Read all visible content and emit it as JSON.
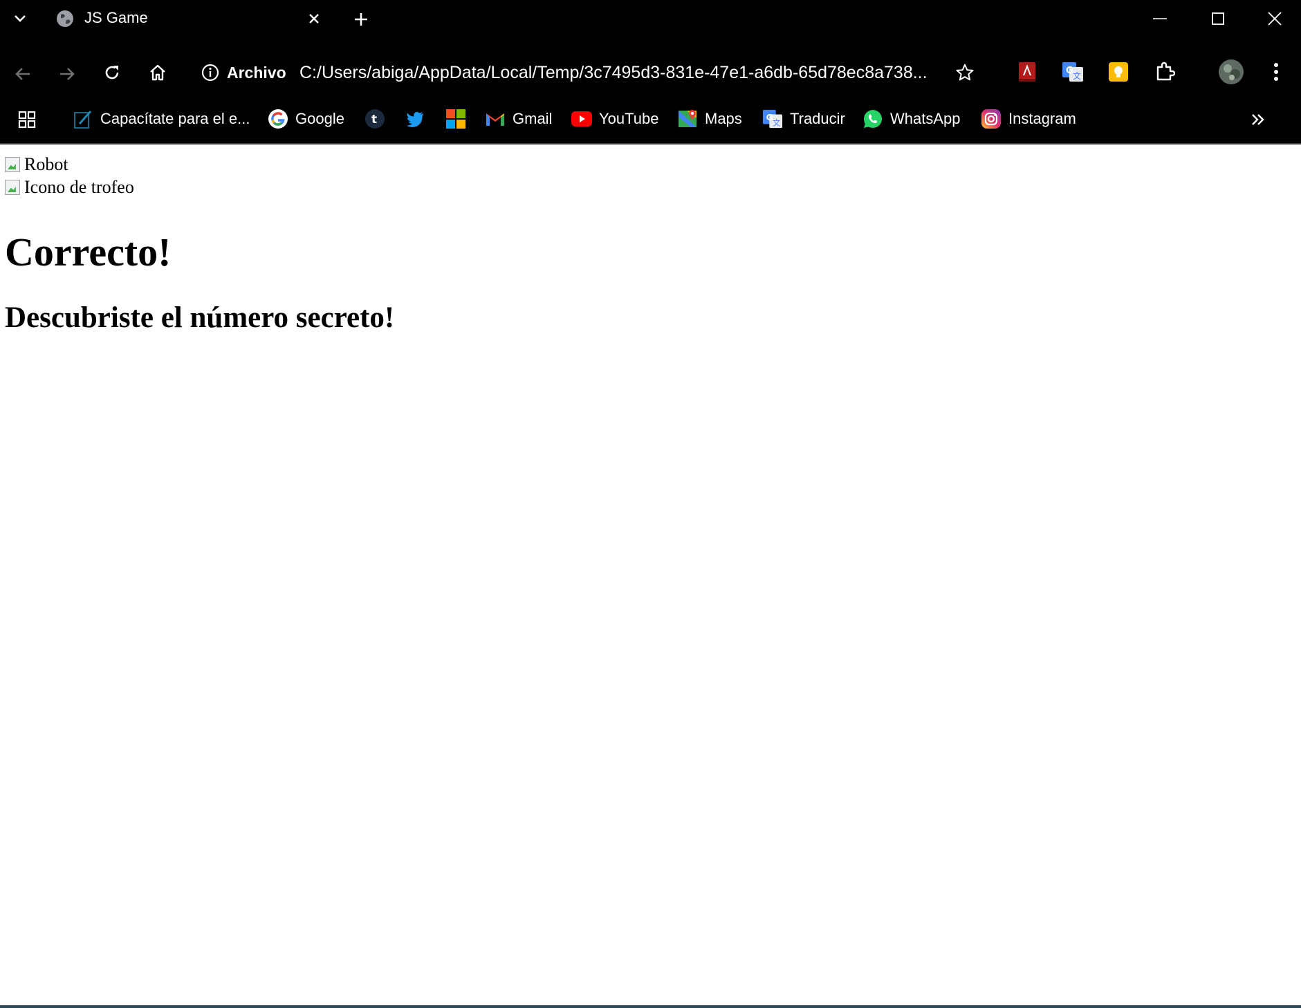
{
  "browser": {
    "tab": {
      "title": "JS Game"
    },
    "address": {
      "security_label": "Archivo",
      "url": "C:/Users/abiga/AppData/Local/Temp/3c7495d3-831e-47e1-a6db-65d78ec8a738..."
    },
    "bookmarks": [
      {
        "label": "Capacítate para el e...",
        "icon": "pen-icon"
      },
      {
        "label": "Google",
        "icon": "google-icon"
      },
      {
        "label": "",
        "icon": "tumblr-icon"
      },
      {
        "label": "",
        "icon": "twitter-icon"
      },
      {
        "label": "",
        "icon": "microsoft-icon"
      },
      {
        "label": "Gmail",
        "icon": "gmail-icon"
      },
      {
        "label": "YouTube",
        "icon": "youtube-icon"
      },
      {
        "label": "Maps",
        "icon": "maps-icon"
      },
      {
        "label": "Traducir",
        "icon": "translate-icon"
      },
      {
        "label": "WhatsApp",
        "icon": "whatsapp-icon"
      },
      {
        "label": "Instagram",
        "icon": "instagram-icon"
      }
    ],
    "colors": {
      "chrome_bg": "#000000",
      "page_bg": "#ffffff"
    }
  },
  "page": {
    "images": [
      {
        "alt": "Robot"
      },
      {
        "alt": "Icono de trofeo"
      }
    ],
    "heading": "Correcto!",
    "subheading": "Descubriste el número secreto!"
  }
}
